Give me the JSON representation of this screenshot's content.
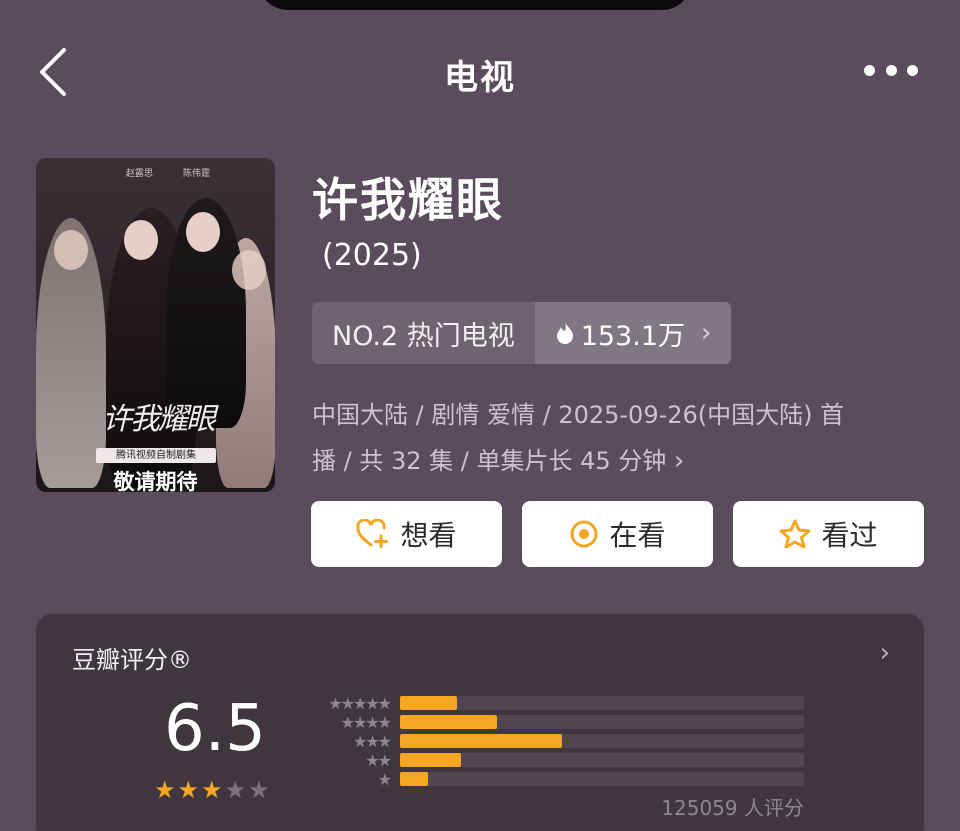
{
  "nav": {
    "title": "电视",
    "back_icon": "chevron-left-icon",
    "more_icon": "more-dots-icon"
  },
  "poster": {
    "calligraphy": "许我耀眼",
    "strip_text": "腾讯视频自制剧集",
    "coming_text": "敬请期待",
    "names": [
      "赵露思",
      "陈伟霆"
    ]
  },
  "show": {
    "title": "许我耀眼",
    "year": "(2025)",
    "rank_label": "NO.2 热门电视",
    "heat_value": "153.1万",
    "heat_icon": "flame-icon",
    "meta_line1": "中国大陆 / 剧情 爱情 / 2025-09-26(中国大陆) 首",
    "meta_line2": "播 / 共 32 集 / 单集片长 45 分钟"
  },
  "actions": [
    {
      "label": "想看",
      "icon": "heart-plus-icon"
    },
    {
      "label": "在看",
      "icon": "target-icon"
    },
    {
      "label": "看过",
      "icon": "star-outline-icon"
    }
  ],
  "rating": {
    "title": "豆瓣评分®",
    "score": "6.5",
    "score_stars": 3,
    "distribution": [
      {
        "label": "★★★★★",
        "percent": 14
      },
      {
        "label": "★★★★",
        "percent": 24
      },
      {
        "label": "★★★",
        "percent": 40
      },
      {
        "label": "★★",
        "percent": 15
      },
      {
        "label": "★",
        "percent": 7
      }
    ],
    "raters": "125059 人评分"
  },
  "colors": {
    "background": "#5a4c5c",
    "card": "#3f3640",
    "accent": "#f5a623"
  }
}
